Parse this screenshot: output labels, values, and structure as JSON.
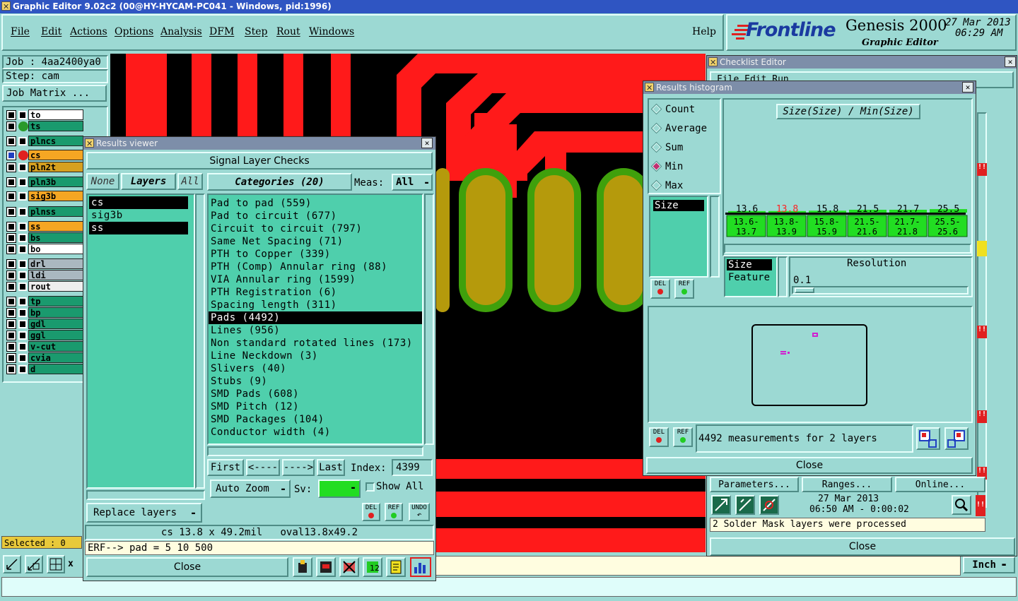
{
  "window": {
    "title": "Graphic Editor 9.02c2 (00@HY-HYCAM-PC041 - Windows, pid:1996)"
  },
  "menu": [
    "File",
    "Edit",
    "Actions",
    "Options",
    "Analysis",
    "DFM",
    "Step",
    "Rout",
    "Windows"
  ],
  "help": "Help",
  "brand": {
    "logo": "Frontline",
    "product": "Genesis 2000",
    "subtitle": "Graphic Editor",
    "date": "27 Mar 2013",
    "time": "06:29 AM"
  },
  "job": {
    "job_label": "Job : 4aa2400ya0",
    "step_label": "Step: cam",
    "matrix_button": "Job Matrix ..."
  },
  "layers": [
    {
      "name": "to",
      "color": "#ffffff"
    },
    {
      "name": "ts",
      "color": "#1a9a6e"
    },
    {
      "name": "plncs",
      "color": "#1a9a6e"
    },
    {
      "name": "cs",
      "color": "#f5a623"
    },
    {
      "name": "pln2t",
      "color": "#d6a020"
    },
    {
      "name": "pln3b",
      "color": "#1a9a6e"
    },
    {
      "name": "sig3b",
      "color": "#f5a623"
    },
    {
      "name": "plnss",
      "color": "#1a9a6e"
    },
    {
      "name": "ss",
      "color": "#f5a623"
    },
    {
      "name": "bs",
      "color": "#1a9a6e"
    },
    {
      "name": "bo",
      "color": "#ffffff"
    },
    {
      "name": "drl",
      "color": "#aab8c0"
    },
    {
      "name": "ldi",
      "color": "#aab8c0"
    },
    {
      "name": "rout",
      "color": "#eeeeee"
    },
    {
      "name": "tp",
      "color": "#1a9a6e"
    },
    {
      "name": "bp",
      "color": "#1a9a6e"
    },
    {
      "name": "gdl",
      "color": "#1a9a6e"
    },
    {
      "name": "ggl",
      "color": "#1a9a6e"
    },
    {
      "name": "v-cut",
      "color": "#1a9a6e"
    },
    {
      "name": "cvia",
      "color": "#1a9a6e"
    },
    {
      "name": "d",
      "color": "#1a9a6e"
    }
  ],
  "selected": "Selected : 0",
  "results_viewer": {
    "title": "Results viewer",
    "header": "Signal Layer Checks",
    "none_btn": "None",
    "layers_btn": "Layers",
    "all_btn": "All",
    "categories_btn": "Categories (20)",
    "meas_label": "Meas:",
    "meas_value": "All",
    "layer_list": [
      "cs",
      "sig3b",
      "ss"
    ],
    "categories": [
      "Pad to pad (559)",
      "Pad to circuit (677)",
      "Circuit to circuit (797)",
      "Same Net Spacing (71)",
      "PTH to Copper (339)",
      "PTH (Comp) Annular ring (88)",
      "VIA Annular ring (1599)",
      "PTH Registration (6)",
      "Spacing length (311)",
      "Pads (4492)",
      "Lines (956)",
      "Non standard rotated lines (173)",
      "Line Neckdown (3)",
      "Slivers (40)",
      "Stubs (9)",
      "SMD Pads (608)",
      "SMD Pitch (12)",
      "SMD Packages (104)",
      "Conductor width (4)"
    ],
    "nav": {
      "first": "First",
      "prev": "<----",
      "next": "---->",
      "last": "Last",
      "index_label": "Index:",
      "index_value": "4399"
    },
    "auto_zoom": "Auto Zoom",
    "sv_label": "Sv:",
    "show_all": "Show All",
    "replace_layers": "Replace layers",
    "del": "DEL",
    "ref": "REF",
    "undo": "UNDO",
    "status_line": "cs 13.8 x 49.2mil   oval13.8x49.2",
    "erf_line": "ERF--> pad = 5 10 500",
    "close": "Close"
  },
  "histogram": {
    "title": "Results histogram",
    "modes": [
      "Count",
      "Average",
      "Sum",
      "Min",
      "Max"
    ],
    "selected_mode": "Min",
    "type_list": [
      "Size"
    ],
    "chart_title": "Size(Size) / Min(Size)",
    "chart_data": {
      "type": "bar",
      "categories": [
        "13.6-13.7",
        "13.8-13.9",
        "15.8-15.9",
        "21.5-21.6",
        "21.7-21.8",
        "25.5-25.6"
      ],
      "values": [
        13.6,
        13.8,
        15.8,
        21.5,
        21.7,
        25.5
      ],
      "top_labels": [
        "13.6",
        "13.8",
        "15.8",
        "21.5",
        "21.7",
        "25.5"
      ],
      "bin_lo": [
        "13.6-",
        "13.8-",
        "15.8-",
        "21.5-",
        "21.7-",
        "25.5-"
      ],
      "bin_hi": [
        "13.7",
        "13.9",
        "15.9",
        "21.6",
        "21.8",
        "25.6"
      ],
      "highlight_index": 1,
      "highlight_color": "#ff2020",
      "bar_color": "#22dd22"
    },
    "attr_list": [
      "Size",
      "Feature"
    ],
    "resolution_label": "Resolution",
    "resolution_value": "0.1",
    "measurements": "4492 measurements for 2 layers",
    "del": "DEL",
    "ref": "REF",
    "close": "Close"
  },
  "checklist": {
    "title": "Checklist Editor",
    "menu_partial": "File  Edit  Run",
    "parameters": "Parameters...",
    "ranges": "Ranges...",
    "online": "Online...",
    "date": "27 Mar 2013",
    "time_range": "06:50 AM - 0:00:02",
    "status": "2 Solder Mask layers were processed",
    "close": "Close",
    "warn": "!!"
  },
  "units": "Inch",
  "colors": {
    "bg": "#9cd9d3",
    "teal_field": "#4fcfac",
    "trace_red": "#ff1a1a",
    "pad_olive": "#b59a0c",
    "pad_green": "#3fa00c",
    "titlebar": "#7d8ea9"
  }
}
